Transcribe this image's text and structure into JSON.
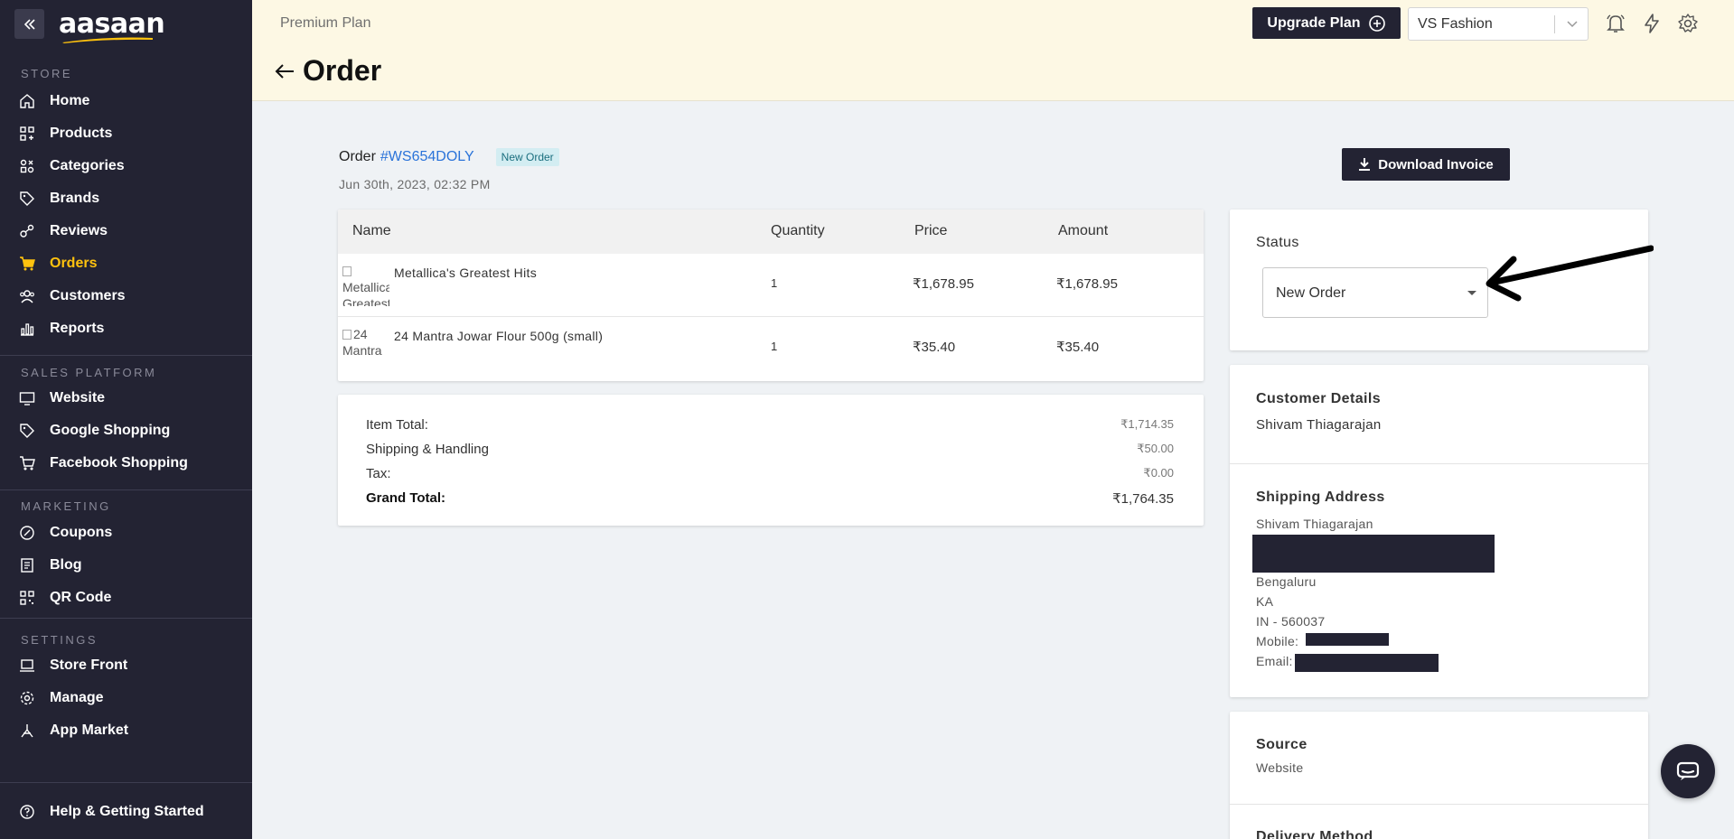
{
  "brand": {
    "logo_text": "aasaan"
  },
  "sidebar": {
    "sections": {
      "store": "STORE",
      "sales_platform": "SALES PLATFORM",
      "marketing": "MARKETING",
      "settings": "SETTINGS"
    },
    "store_items": [
      {
        "label": "Home",
        "icon": "home-icon"
      },
      {
        "label": "Products",
        "icon": "products-icon"
      },
      {
        "label": "Categories",
        "icon": "categories-icon"
      },
      {
        "label": "Brands",
        "icon": "tag-icon"
      },
      {
        "label": "Reviews",
        "icon": "reviews-icon"
      },
      {
        "label": "Orders",
        "icon": "cart-icon",
        "active": true
      },
      {
        "label": "Customers",
        "icon": "customers-icon"
      },
      {
        "label": "Reports",
        "icon": "reports-icon"
      }
    ],
    "sales_items": [
      {
        "label": "Website",
        "icon": "monitor-icon"
      },
      {
        "label": "Google Shopping",
        "icon": "tag-icon"
      },
      {
        "label": "Facebook Shopping",
        "icon": "cart-icon"
      }
    ],
    "marketing_items": [
      {
        "label": "Coupons",
        "icon": "coupon-icon"
      },
      {
        "label": "Blog",
        "icon": "blog-icon"
      },
      {
        "label": "QR Code",
        "icon": "qr-icon"
      }
    ],
    "settings_items": [
      {
        "label": "Store Front",
        "icon": "storefront-icon"
      },
      {
        "label": "Manage",
        "icon": "gear-icon"
      },
      {
        "label": "App Market",
        "icon": "app-market-icon"
      }
    ],
    "help_label": "Help & Getting Started",
    "active_color": "#ffc20e"
  },
  "header": {
    "plan": "Premium Plan",
    "title": "Order",
    "upgrade_label": "Upgrade Plan",
    "store_name": "VS Fashion"
  },
  "order": {
    "label": "Order",
    "id": "#WS654DOLY",
    "badge": "New Order",
    "date": "Jun 30th, 2023, 02:32 PM",
    "download_label": "Download Invoice"
  },
  "items_table": {
    "columns": [
      "Name",
      "Quantity",
      "Price",
      "Amount"
    ],
    "rows": [
      {
        "thumb_alt": "Metallica's Greatest Hits",
        "name": "Metallica's Greatest Hits",
        "quantity": "1",
        "price": "₹1,678.95",
        "amount": "₹1,678.95"
      },
      {
        "thumb_alt": "24 Mantra",
        "name": "24 Mantra Jowar Flour 500g (small)",
        "quantity": "1",
        "price": "₹35.40",
        "amount": "₹35.40"
      }
    ]
  },
  "totals": {
    "item_total_label": "Item Total:",
    "item_total": "₹1,714.35",
    "shipping_label": "Shipping & Handling",
    "shipping": "₹50.00",
    "tax_label": "Tax:",
    "tax": "₹0.00",
    "grand_label": "Grand Total:",
    "grand": "₹1,764.35"
  },
  "status_card": {
    "title": "Status",
    "value": "New Order"
  },
  "customer_card": {
    "title": "Customer Details",
    "name": "Shivam Thiagarajan",
    "shipping_title": "Shipping Address",
    "ship_name": "Shivam Thiagarajan",
    "city": "Bengaluru",
    "state": "KA",
    "postal": "IN - 560037",
    "mobile_label": "Mobile:",
    "email_label": "Email:"
  },
  "source_card": {
    "title": "Source",
    "value": "Website",
    "delivery_title": "Delivery Method"
  }
}
